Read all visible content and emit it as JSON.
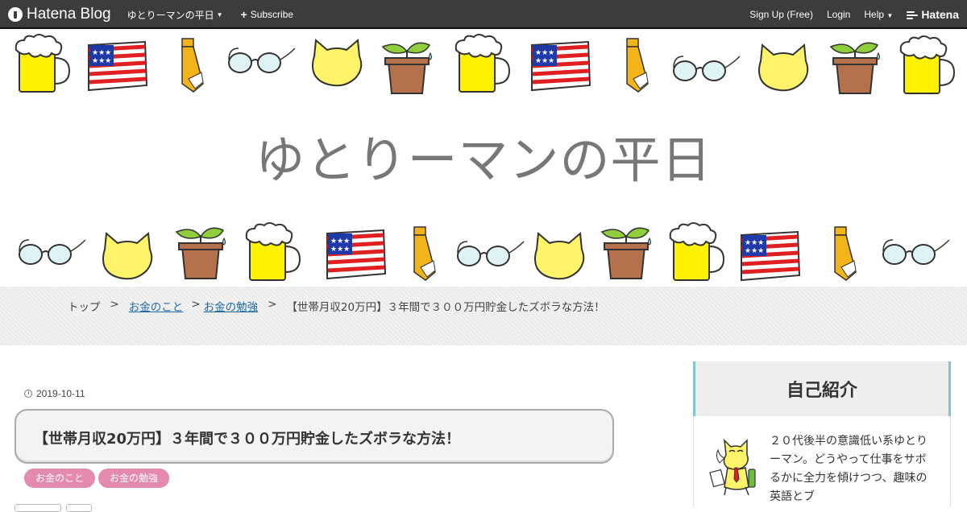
{
  "navbar": {
    "logo_text": "Hatena Blog",
    "blog_menu_label": "ゆとりーマンの平日",
    "subscribe_label": "Subscribe",
    "signup_label": "Sign Up (Free)",
    "login_label": "Login",
    "help_label": "Help",
    "hatena_label": "Hatena"
  },
  "header": {
    "title": "ゆとりーマンの平日",
    "decorations": [
      "beer-mug",
      "us-flag",
      "necktie",
      "glasses",
      "cat-face",
      "potted-sprout"
    ]
  },
  "breadcrumb": {
    "top": "トップ",
    "sep": ">",
    "cat1": "お金のこと",
    "cat2": "お金の勉強",
    "current": "【世帯月収20万円】３年間で３００万円貯金したズボラな方法！"
  },
  "entry": {
    "date": "2019-10-11",
    "title": "【世帯月収20万円】３年間で３００万円貯金したズボラな方法！",
    "categories": [
      "お金のこと",
      "お金の勉強"
    ]
  },
  "sidebar": {
    "profile_heading": "自己紹介",
    "profile_text": "２０代後半の意識低い系ゆとりーマン。どうやって仕事をサボるかに全力を傾けつつ、趣味の英語とブ"
  },
  "colors": {
    "navbar": "#3c3c3c",
    "category_tag": "#e48aac",
    "sidebar_accent": "#7fc3d3",
    "link": "#1f6aa8"
  }
}
